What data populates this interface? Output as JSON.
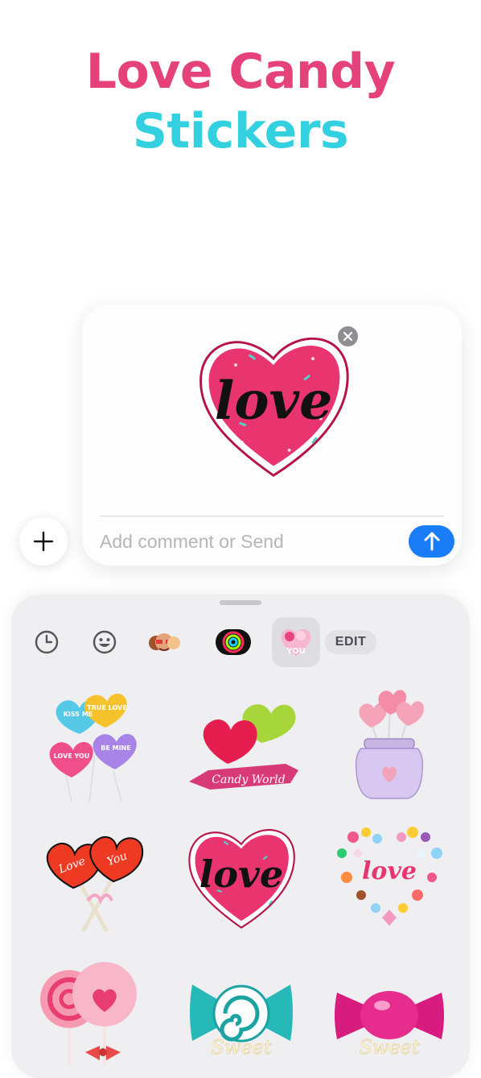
{
  "promo": {
    "title_line1": "Love Candy",
    "title_line2": "Stickers"
  },
  "compose": {
    "comment_placeholder": "Add comment or Send",
    "comment_value": "",
    "selected_sticker": {
      "icon": "love-heart-sticker",
      "text": "love"
    }
  },
  "drawer": {
    "tabs": [
      {
        "icon": "recents-clock-icon"
      },
      {
        "icon": "emoji-icon"
      },
      {
        "icon": "memoji-icon"
      },
      {
        "icon": "activity-rings-icon"
      },
      {
        "icon": "love-candy-app-icon",
        "label": "YOU",
        "selected": true
      }
    ],
    "edit_label": "EDIT",
    "stickers": [
      {
        "name": "conversation-hearts-balloons",
        "texts": [
          "KISS ME",
          "TRUE LOVE",
          "LOVE YOU",
          "BE MINE"
        ]
      },
      {
        "name": "candy-world-lollipops",
        "text": "Candy World"
      },
      {
        "name": "jar-of-heart-lollipops"
      },
      {
        "name": "love-you-lollipops",
        "texts": [
          "Love",
          "You"
        ]
      },
      {
        "name": "love-heart-candy",
        "text": "love"
      },
      {
        "name": "candy-heart-love",
        "text": "love"
      },
      {
        "name": "swirl-lollipops-bow"
      },
      {
        "name": "sweet-teal-wrapped-candy",
        "text": "Sweet"
      },
      {
        "name": "sweet-pink-wrapped-candy",
        "text": "Sweet"
      }
    ]
  },
  "colors": {
    "title_pink": "#e5417b",
    "title_cyan": "#33d1e0",
    "send_blue": "#1a7cf6",
    "drawer_bg": "#efeff1"
  }
}
